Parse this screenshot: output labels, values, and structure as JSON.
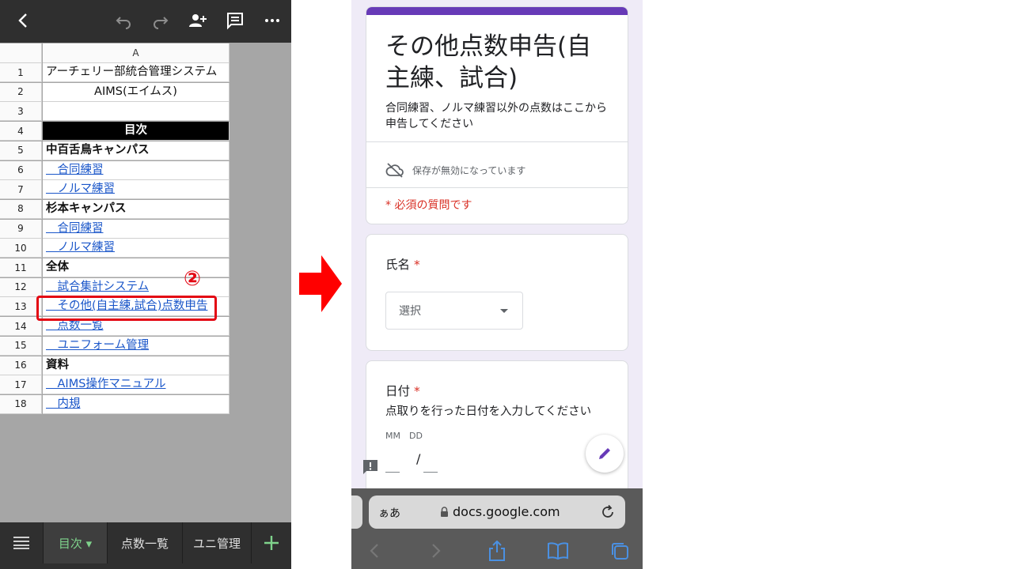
{
  "spreadsheet": {
    "column_header": "A",
    "rows": [
      {
        "num": "1",
        "text": "アーチェリー部統合管理システム",
        "style": "plain"
      },
      {
        "num": "2",
        "text": "AIMS(エイムス)",
        "style": "center"
      },
      {
        "num": "3",
        "text": "",
        "style": "plain"
      },
      {
        "num": "4",
        "text": "目次",
        "style": "header"
      },
      {
        "num": "5",
        "text": "中百舌鳥キャンパス",
        "style": "bold"
      },
      {
        "num": "6",
        "text": "　合同練習",
        "style": "link"
      },
      {
        "num": "7",
        "text": "　ノルマ練習",
        "style": "link"
      },
      {
        "num": "8",
        "text": "杉本キャンパス",
        "style": "bold"
      },
      {
        "num": "9",
        "text": "　合同練習",
        "style": "link"
      },
      {
        "num": "10",
        "text": "　ノルマ練習",
        "style": "link"
      },
      {
        "num": "11",
        "text": "全体",
        "style": "bold"
      },
      {
        "num": "12",
        "text": "　試合集計システム",
        "style": "link"
      },
      {
        "num": "13",
        "text": "　その他(自主練,試合)点数申告",
        "style": "link"
      },
      {
        "num": "14",
        "text": "　点数一覧",
        "style": "link"
      },
      {
        "num": "15",
        "text": "　ユニフォーム管理",
        "style": "link"
      },
      {
        "num": "16",
        "text": "資料",
        "style": "bold"
      },
      {
        "num": "17",
        "text": "　AIMS操作マニュアル",
        "style": "link"
      },
      {
        "num": "18",
        "text": "　内規",
        "style": "link"
      }
    ],
    "step_marker": "②",
    "sheet_tabs": [
      {
        "label": "目次 ▾",
        "active": true
      },
      {
        "label": "点数一覧",
        "active": false
      },
      {
        "label": "ユニ管理",
        "active": false
      }
    ]
  },
  "form": {
    "title": "その他点数申告(自主練、試合)",
    "description": "合同練習、ノルマ練習以外の点数はここから申告してください",
    "save_status": "保存が無効になっています",
    "required_note": "* 必須の質問です",
    "questions": {
      "name": {
        "label": "氏名",
        "required_mark": "*",
        "select_placeholder": "選択"
      },
      "date": {
        "label": "日付",
        "required_mark": "*",
        "description": "点取りを行った日付を入力してください",
        "month_label": "MM",
        "day_label": "DD",
        "separator": "/"
      }
    }
  },
  "browser": {
    "aa_label": "ぁあ",
    "url": "docs.google.com"
  },
  "colors": {
    "accent_purple": "#673ab7",
    "required_red": "#d93025",
    "highlight_red": "#e30613",
    "link_blue": "#1a56c9"
  }
}
